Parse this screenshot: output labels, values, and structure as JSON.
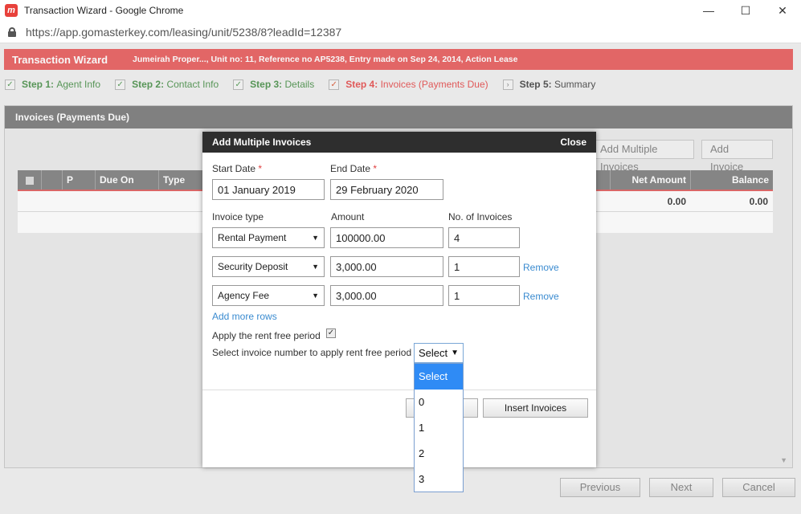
{
  "window": {
    "title": "Transaction Wizard - Google Chrome",
    "logo": "m",
    "url": "https://app.gomasterkey.com/leasing/unit/5238/8?leadId=12387",
    "minimize": "—",
    "maximize": "☐",
    "close": "✕"
  },
  "wizard": {
    "title": "Transaction Wizard",
    "info": "Jumeirah Proper..., Unit no: 11, Reference no AP5238, Entry made on Sep 24, 2014, Action Lease"
  },
  "steps": [
    {
      "num": "Step 1:",
      "label": "Agent Info",
      "state": "done",
      "mark": "✓"
    },
    {
      "num": "Step 2:",
      "label": "Contact Info",
      "state": "done",
      "mark": "✓"
    },
    {
      "num": "Step 3:",
      "label": "Details",
      "state": "done",
      "mark": "✓"
    },
    {
      "num": "Step 4:",
      "label": "Invoices (Payments Due)",
      "state": "active",
      "mark": "✓"
    },
    {
      "num": "Step 5:",
      "label": "Summary",
      "state": "pending",
      "mark": "›"
    }
  ],
  "panel": {
    "title": "Invoices (Payments Due)",
    "add_multiple": "Add Multiple Invoices",
    "add_invoice": "Add Invoice",
    "columns": [
      "",
      "P No.",
      "Due On",
      "Type",
      "Net Amount",
      "Balance"
    ],
    "net_total": "0.00",
    "balance_total": "0.00"
  },
  "footer": {
    "previous": "Previous",
    "next": "Next",
    "cancel": "Cancel"
  },
  "modal": {
    "title": "Add Multiple Invoices",
    "close": "Close",
    "start_date_label": "Start Date",
    "end_date_label": "End Date",
    "required_mark": "*",
    "start_date": "01 January 2019",
    "end_date": "29 February 2020",
    "invoice_type_label": "Invoice type",
    "amount_label": "Amount",
    "count_label": "No. of Invoices",
    "rows": [
      {
        "type": "Rental Payment",
        "amount": "100000.00",
        "count": "4",
        "remove": ""
      },
      {
        "type": "Security Deposit",
        "amount": "3,000.00",
        "count": "1",
        "remove": "Remove"
      },
      {
        "type": "Agency Fee",
        "amount": "3,000.00",
        "count": "1",
        "remove": "Remove"
      }
    ],
    "add_more_rows": "Add more rows",
    "rent_free_label": "Apply the rent free period",
    "rent_free_checked": true,
    "rent_free_select_label": "Select invoice number to apply rent free period",
    "rent_free_select_value": "Select",
    "insert_button": "Insert Invoices"
  },
  "dropdown": {
    "options": [
      "Select",
      "0",
      "1",
      "2",
      "3"
    ],
    "selected": "Select"
  },
  "colors": {
    "accent_red": "#ea6a6a",
    "step_done": "#5a9a5a",
    "link_blue": "#3a8bd0",
    "select_highlight": "#2f8bf5"
  }
}
